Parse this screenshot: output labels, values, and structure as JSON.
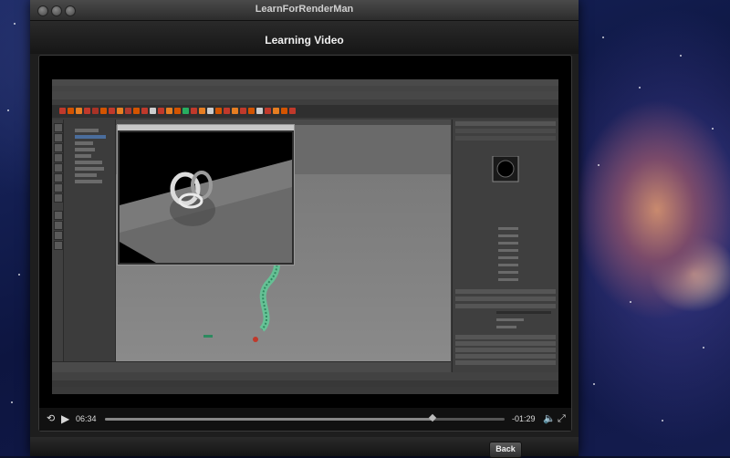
{
  "window": {
    "title": "LearnForRenderMan"
  },
  "header": {
    "title": "Learning Video"
  },
  "player": {
    "elapsed": "06:34",
    "remaining": "-01:29",
    "progress": 0.82,
    "icons": {
      "rewind": "rewind-15-icon",
      "play": "play-icon",
      "volume": "volume-icon",
      "fullscreen": "fullscreen-icon"
    }
  },
  "footer": {
    "back_label": "Back"
  },
  "colors": {
    "window_bg": "#1e1e1e",
    "video_bg": "#000000",
    "maya_ui": "#3b3b3b",
    "accent_green": "#3fbf80"
  }
}
